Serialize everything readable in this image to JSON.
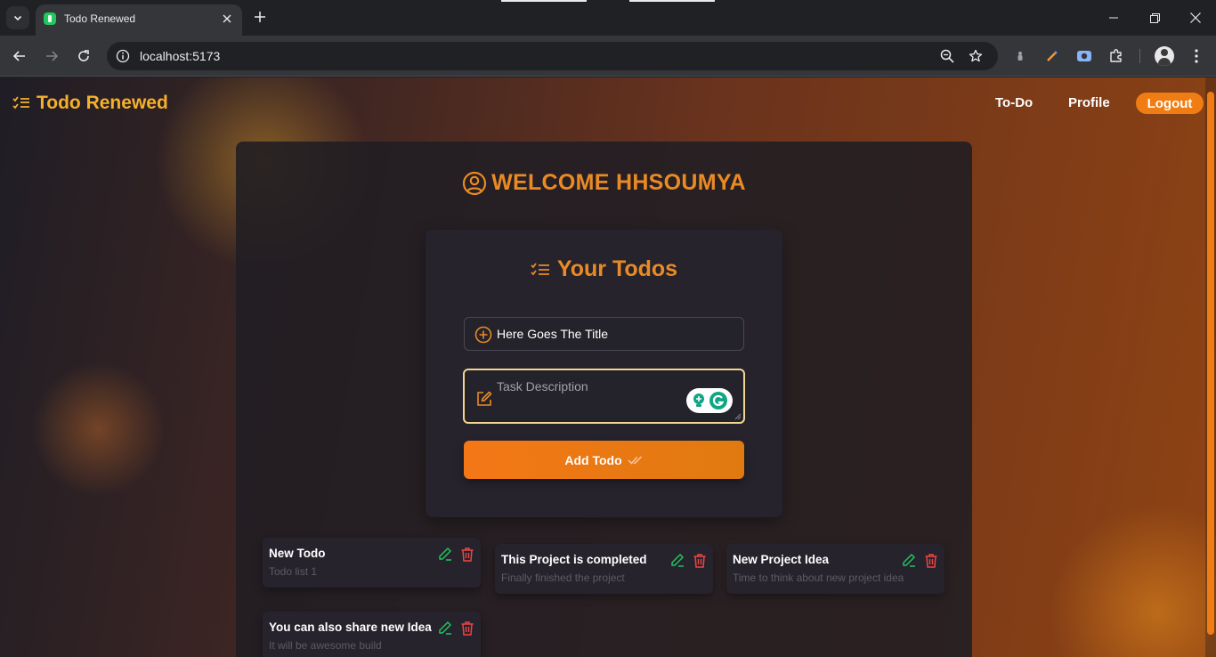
{
  "browser": {
    "tab_title": "Todo Renewed",
    "url": "localhost:5173"
  },
  "app": {
    "brand": "Todo Renewed",
    "nav": {
      "todo": "To-Do",
      "profile": "Profile",
      "logout": "Logout"
    },
    "welcome": "WELCOME HHSOUMYA",
    "todo_form": {
      "heading": "Your Todos",
      "title_value": "Here Goes The Title",
      "description_placeholder": "Task Description",
      "add_button": "Add Todo"
    },
    "todos": [
      {
        "title": "New Todo",
        "description": "Todo list 1"
      },
      {
        "title": "This Project is completed",
        "description": "Finally finished the project"
      },
      {
        "title": "New Project Idea",
        "description": "Time to think about new project idea"
      },
      {
        "title": "You can also share new Idea",
        "description": "It will be awesome build"
      }
    ]
  },
  "colors": {
    "accent": "#f07d14",
    "brand_text": "#f5b02b",
    "heading": "#ea8a25",
    "edit_icon": "#22c55e",
    "delete_icon": "#ef4444"
  }
}
